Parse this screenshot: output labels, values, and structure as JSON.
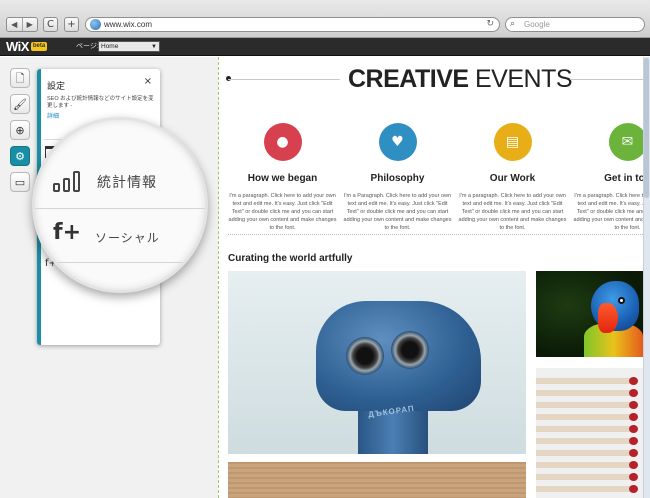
{
  "browser": {
    "back": "◀",
    "forward": "▶",
    "reload": "C",
    "new_tab": "+",
    "address": "www.wix.com",
    "search_placeholder": "Google"
  },
  "editor": {
    "logo": "WiX",
    "logo_badge": "beta",
    "page_label": "ページ:",
    "page_value": "Home"
  },
  "side_toolbar": {
    "items": [
      {
        "icon": "page-icon",
        "glyph": "🗋"
      },
      {
        "icon": "brush-icon",
        "glyph": "🖌"
      },
      {
        "icon": "add-icon",
        "glyph": "⊕"
      },
      {
        "icon": "gear-icon",
        "glyph": "⚙",
        "active": true
      },
      {
        "icon": "media-icon",
        "glyph": "▭"
      }
    ]
  },
  "settings_panel": {
    "title": "設定",
    "close": "×",
    "description": "SEO および統計情報などのサイト設定を変更します -",
    "link": "詳細"
  },
  "magnifier": {
    "stats_label": "統計情報",
    "social_label": "ソーシャル"
  },
  "site": {
    "hero_bold": "CREATIVE",
    "hero_light": " EVENTS",
    "features": [
      {
        "title": "How we began",
        "icon": "person-icon",
        "color": "#d7404e",
        "glyph": "●",
        "body": "I'm a paragraph. Click here to add your own text and edit me. It's easy. Just click \"Edit Text\" or double click me and you can start adding your own content and make changes to the font."
      },
      {
        "title": "Philosophy",
        "icon": "heart-icon",
        "color": "#2f8fc2",
        "glyph": "♥",
        "body": "I'm a Paragraph. Click here to add your own text and edit me. It's easy. Just click \"Edit Text\" or double click me and you can start adding your own content and make changes to the font."
      },
      {
        "title": "Our Work",
        "icon": "document-icon",
        "color": "#e8ae17",
        "glyph": "▤",
        "body": "I'm a paragraph. Click here to add your own text and edit me. It's easy. Just click \"Edit Text\" or double click me and you can start adding your own content and make changes to the font."
      },
      {
        "title": "Get in tou",
        "icon": "mail-icon",
        "color": "#6bb33b",
        "glyph": "✉",
        "body": "I'm a paragraph. Click here to add your own text and edit me. It's easy. Just click \"Edit Text\" or double click me and you can start adding your own content and make changes to the font."
      }
    ],
    "section_title": "Curating the world artfully",
    "binocular_text": "ДЪКОРАП"
  }
}
